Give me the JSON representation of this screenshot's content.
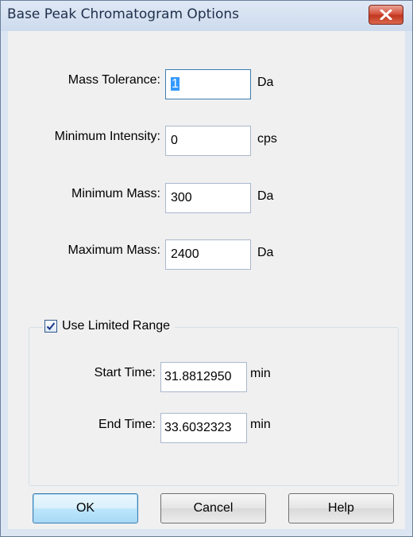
{
  "window": {
    "title": "Base Peak Chromatogram Options"
  },
  "fields": {
    "mass_tolerance": {
      "label": "Mass Tolerance:",
      "value": "1",
      "unit": "Da"
    },
    "minimum_intensity": {
      "label": "Minimum Intensity:",
      "value": "0",
      "unit": "cps"
    },
    "minimum_mass": {
      "label": "Minimum Mass:",
      "value": "300",
      "unit": "Da"
    },
    "maximum_mass": {
      "label": "Maximum Mass:",
      "value": "2400",
      "unit": "Da"
    }
  },
  "limited_range": {
    "label": "Use Limited Range",
    "checked": true,
    "start_time": {
      "label": "Start Time:",
      "value": "31.8812950",
      "unit": "min"
    },
    "end_time": {
      "label": "End Time:",
      "value": "33.6032323",
      "unit": "min"
    }
  },
  "buttons": {
    "ok": "OK",
    "cancel": "Cancel",
    "help": "Help"
  },
  "icons": {
    "close": "close-icon",
    "check": "checkmark-icon"
  },
  "colors": {
    "selection": "#3399ff",
    "close_button": "#c2371f",
    "dialog_background": "#f0f0f0"
  }
}
